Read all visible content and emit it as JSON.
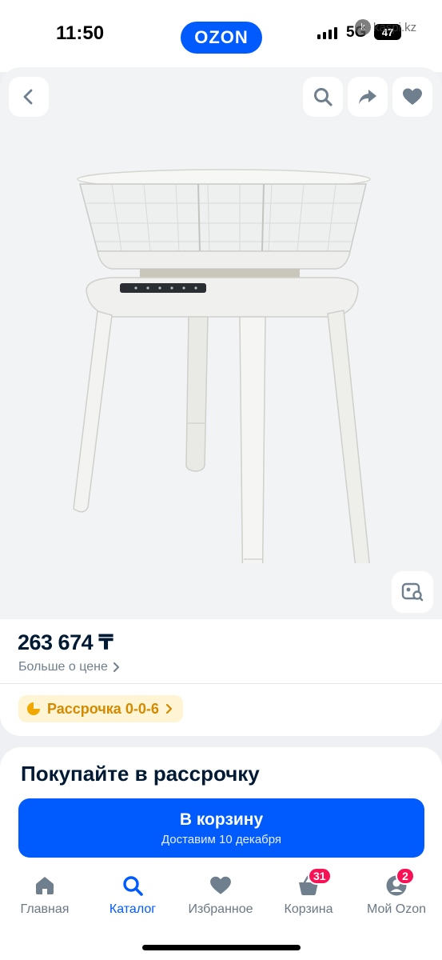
{
  "status_bar": {
    "time": "11:50",
    "network": "5G",
    "battery": "47",
    "watermark": "kaspi.kz"
  },
  "header": {
    "logo": "OZON",
    "icons": [
      "back-icon",
      "search-icon",
      "share-icon",
      "heart-icon"
    ]
  },
  "product": {
    "price": "263 674 ₸",
    "price_more": "Больше о цене",
    "installment": "Рассрочка 0-0-6"
  },
  "buy_panel": {
    "title": "Покупайте в рассрочку",
    "cart_label": "В корзину",
    "cart_sub": "Доставим 10 декабря"
  },
  "tabs": [
    {
      "label": "Главная",
      "icon": "home-icon",
      "active": false
    },
    {
      "label": "Каталог",
      "icon": "search-icon",
      "active": true
    },
    {
      "label": "Избранное",
      "icon": "heart-icon",
      "active": false
    },
    {
      "label": "Корзина",
      "icon": "basket-icon",
      "badge": "31",
      "active": false
    },
    {
      "label": "Мой Ozon",
      "icon": "profile-icon",
      "badge": "2",
      "active": false
    }
  ],
  "colors": {
    "brand": "#005bff",
    "badge": "#f91155",
    "installment": "#d38a00"
  }
}
